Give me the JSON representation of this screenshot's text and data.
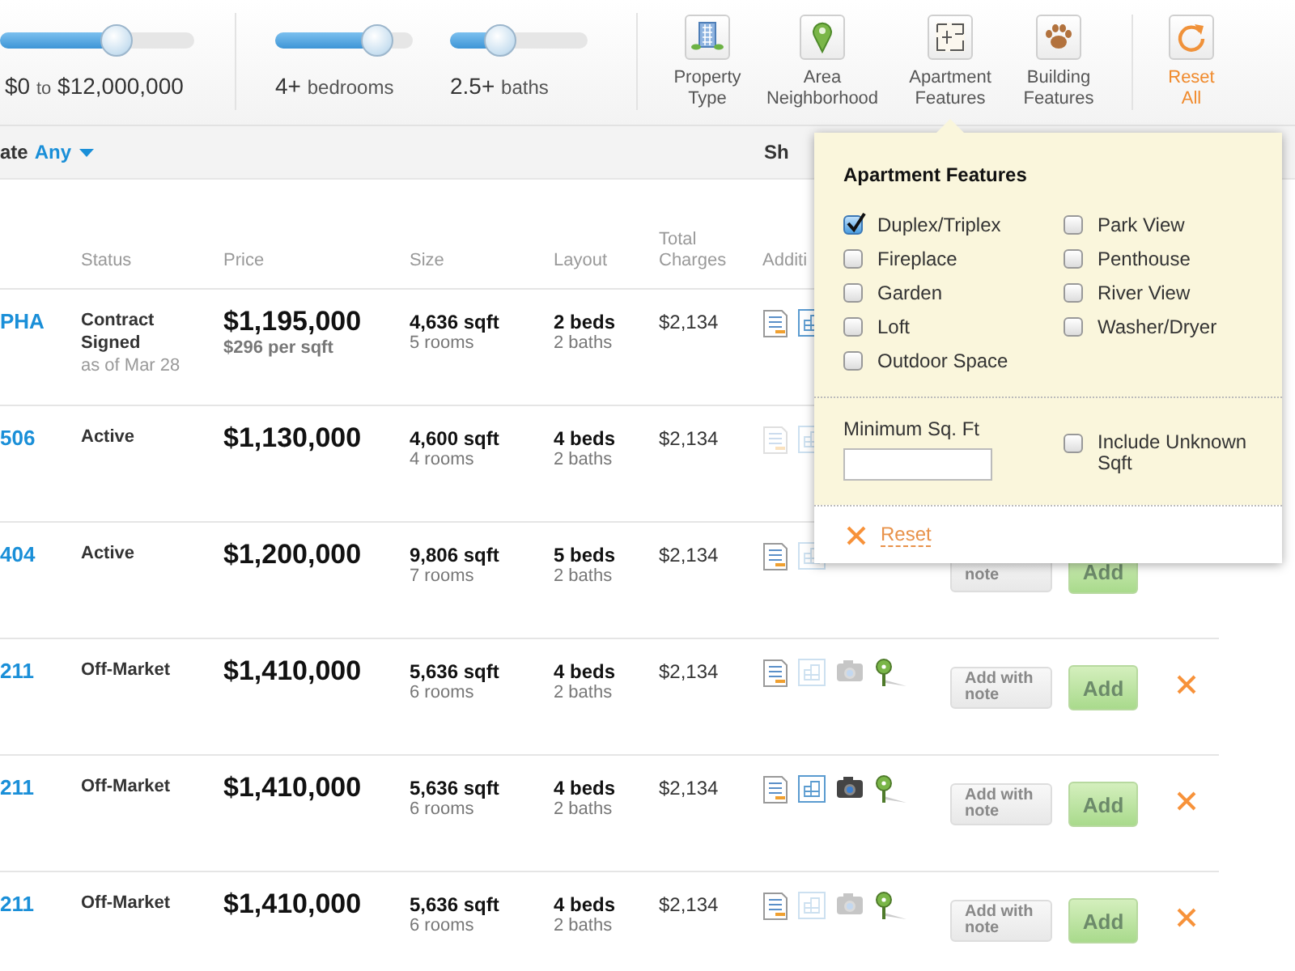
{
  "filters": {
    "price": {
      "min": "$0",
      "separator": "to",
      "max": "$12,000,000",
      "level": 0.6
    },
    "bedrooms": {
      "value": "4+",
      "unit": "bedrooms",
      "level": 0.74
    },
    "baths": {
      "value": "2.5+",
      "unit": "baths",
      "level": 0.36
    },
    "categories": [
      {
        "kind": "building",
        "label": "Property Type"
      },
      {
        "kind": "pin",
        "label": "Area Neighborhood"
      },
      {
        "kind": "floorplan",
        "label": "Apartment Features"
      },
      {
        "kind": "paw",
        "label": "Building Features"
      }
    ],
    "reset": {
      "label": "Reset All"
    }
  },
  "sort_bar": {
    "label": "ate",
    "value": "Any",
    "column_2": "Sh"
  },
  "table": {
    "columns": [
      "Status",
      "Price",
      "Size",
      "Layout",
      "Total Charges",
      "Additi"
    ],
    "rows": [
      {
        "address": "PHA",
        "status": "Contract Signed",
        "status_note": "as of Mar 28",
        "price": "$1,195,000",
        "price_note": "$296 per sqft",
        "size": "4,636 sqft",
        "rooms": "5 rooms",
        "beds": "2 beds",
        "baths": "2 baths",
        "charges": "$2,134",
        "media": [
          {
            "kind": "doc",
            "available": true
          },
          {
            "kind": "floorplan",
            "available": true
          }
        ]
      },
      {
        "address": "506",
        "status": "Active",
        "price": "$1,130,000",
        "size": "4,600 sqft",
        "rooms": "4 rooms",
        "beds": "4 beds",
        "baths": "2 baths",
        "charges": "$2,134",
        "media": [
          {
            "kind": "doc",
            "available": false
          },
          {
            "kind": "floorplan",
            "available": false
          }
        ]
      },
      {
        "address": "404",
        "status": "Active",
        "price": "$1,200,000",
        "size": "9,806 sqft",
        "rooms": "7 rooms",
        "beds": "5 beds",
        "baths": "2 baths",
        "charges": "$2,134",
        "media": [
          {
            "kind": "doc",
            "available": true
          },
          {
            "kind": "floorplan",
            "available": false
          }
        ],
        "actions": {
          "note_button": "note",
          "add_button": "Add"
        }
      },
      {
        "address": "211",
        "status": "Off-Market",
        "price": "$1,410,000",
        "size": "5,636 sqft",
        "rooms": "6 rooms",
        "beds": "4 beds",
        "baths": "2 baths",
        "charges": "$2,134",
        "media": [
          {
            "kind": "doc",
            "available": true
          },
          {
            "kind": "floorplan",
            "available": false
          },
          {
            "kind": "camera",
            "available": false
          },
          {
            "kind": "pin",
            "available": true
          }
        ],
        "actions": {
          "note_button": "Add with note",
          "add_button": "Add",
          "remove": true
        }
      },
      {
        "address": "211",
        "status": "Off-Market",
        "price": "$1,410,000",
        "size": "5,636 sqft",
        "rooms": "6 rooms",
        "beds": "4 beds",
        "baths": "2 baths",
        "charges": "$2,134",
        "media": [
          {
            "kind": "doc",
            "available": true
          },
          {
            "kind": "floorplan",
            "available": true
          },
          {
            "kind": "camera",
            "available": true
          },
          {
            "kind": "pin",
            "available": true
          }
        ],
        "actions": {
          "note_button": "Add with note",
          "add_button": "Add",
          "remove": true
        }
      },
      {
        "address": "211",
        "status": "Off-Market",
        "price": "$1,410,000",
        "size": "5,636 sqft",
        "rooms": "6 rooms",
        "beds": "4 beds",
        "baths": "2 baths",
        "charges": "$2,134",
        "media": [
          {
            "kind": "doc",
            "available": true
          },
          {
            "kind": "floorplan",
            "available": false
          },
          {
            "kind": "camera",
            "available": false
          },
          {
            "kind": "pin",
            "available": true
          }
        ],
        "actions": {
          "note_button": "Add with note",
          "add_button": "Add",
          "remove": true
        }
      }
    ]
  },
  "popover": {
    "title": "Apartment Features",
    "features": [
      {
        "label": "Duplex/Triplex",
        "checked": true
      },
      {
        "label": "Fireplace",
        "checked": false
      },
      {
        "label": "Garden",
        "checked": false
      },
      {
        "label": "Loft",
        "checked": false
      },
      {
        "label": "Outdoor Space",
        "checked": false
      },
      {
        "label": "Park View",
        "checked": false
      },
      {
        "label": "Penthouse",
        "checked": false
      },
      {
        "label": "River View",
        "checked": false
      },
      {
        "label": "Washer/Dryer",
        "checked": false
      }
    ],
    "min_sqft": {
      "label": "Minimum Sq. Ft"
    },
    "include_unknown": {
      "label": "Include Unknown Sqft",
      "checked": false
    },
    "reset": {
      "label": "Reset"
    }
  }
}
